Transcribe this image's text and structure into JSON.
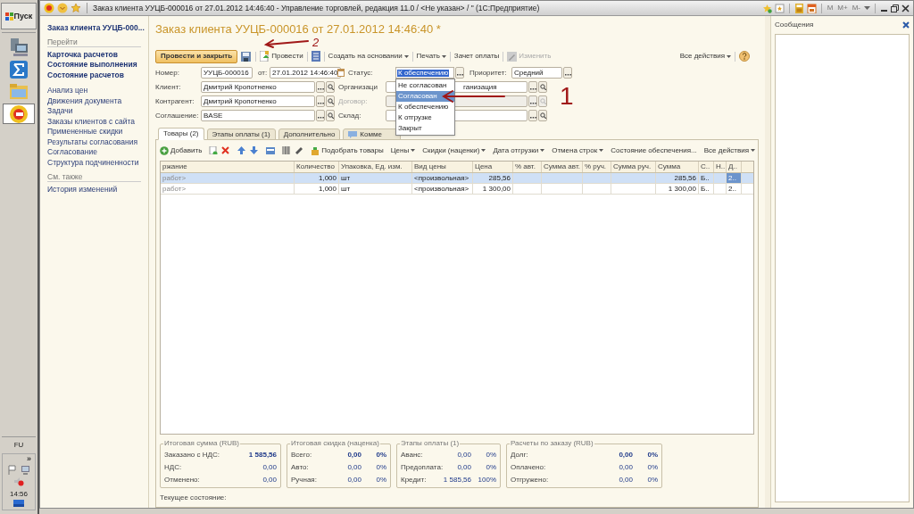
{
  "taskbar": {
    "start": "Пуск",
    "apps": [
      {
        "kind": "computer",
        "selected": false
      },
      {
        "kind": "sigma",
        "selected": false
      },
      {
        "kind": "folder",
        "selected": false
      },
      {
        "kind": "onec",
        "selected": true
      }
    ],
    "language": "FU",
    "tray_chevron": "»",
    "clock": "14:56"
  },
  "window": {
    "title": "Заказ клиента УУЦБ-000016 от 27.01.2012 14:46:40 - Управление торговлей, редакция 11.0 / <Не указан> / \" (1С:Предприятие)",
    "tools": [
      "M",
      "M+",
      "M-"
    ]
  },
  "nav": {
    "title": "Заказ клиента УУЦБ-000...",
    "sections": [
      {
        "heading": "Перейти",
        "items": [
          {
            "label": "Карточка расчетов",
            "bold": true
          },
          {
            "label": "Состояние выполнения",
            "bold": true
          },
          {
            "label": "Состояние расчетов",
            "bold": true
          },
          {
            "label": "Анализ цен",
            "bold": false
          },
          {
            "label": "Движения документа",
            "bold": false
          },
          {
            "label": "Задачи",
            "bold": false
          },
          {
            "label": "Заказы клиентов с сайта",
            "bold": false
          },
          {
            "label": "Примененные скидки",
            "bold": false
          },
          {
            "label": "Результаты согласования",
            "bold": false
          },
          {
            "label": "Согласование",
            "bold": false
          },
          {
            "label": "Структура подчиненности",
            "bold": false
          }
        ]
      },
      {
        "heading": "См. также",
        "items": [
          {
            "label": "История изменений",
            "bold": false
          }
        ]
      }
    ]
  },
  "form": {
    "title": "Заказ клиента УУЦБ-000016 от 27.01.2012 14:46:40 *",
    "toolbar": [
      {
        "kind": "primary",
        "label": "Провести и закрыть",
        "disabled": false
      },
      {
        "kind": "save"
      },
      {
        "kind": "post",
        "label": "Провести",
        "disabled": false
      },
      {
        "kind": "structure"
      },
      {
        "kind": "menu",
        "label": "Создать на основании",
        "disabled": false
      },
      {
        "kind": "menu",
        "label": "Печать",
        "disabled": false
      },
      {
        "kind": "plain",
        "label": "Зачет оплаты",
        "disabled": false
      },
      {
        "kind": "edit",
        "label": "Изменить",
        "disabled": true
      }
    ],
    "all_actions": "Все действия",
    "fields": {
      "number": {
        "label": "Номер:",
        "value": "УУЦБ-000016"
      },
      "date": {
        "label": "от:",
        "value": "27.01.2012 14:46:40"
      },
      "status": {
        "label": "Статус:",
        "value": "К обеспечению"
      },
      "priority": {
        "label": "Приоритет:",
        "value": "Средний"
      },
      "client": {
        "label": "Клиент:",
        "value": "Дмитрий Кропотненко"
      },
      "organization": {
        "label": "Организаци",
        "value": "ганизация"
      },
      "counterparty": {
        "label": "Контрагент:",
        "value": "Дмитрий Кропотненко"
      },
      "contract": {
        "label": "Договор:",
        "disabled": true
      },
      "agreement": {
        "label": "Соглашение:",
        "value": "BASE"
      },
      "warehouse": {
        "label": "Склад:",
        "disabled": false
      }
    },
    "status_options": [
      {
        "label": "Не согласован",
        "selected": false
      },
      {
        "label": "Согласован",
        "selected": true
      },
      {
        "label": "К обеспечению",
        "selected": false
      },
      {
        "label": "К отгрузке",
        "selected": false
      },
      {
        "label": "Закрыт",
        "selected": false
      }
    ],
    "tabs": [
      {
        "label": "Товары (2)",
        "selected": true,
        "kind": "plain"
      },
      {
        "label": "Этапы оплаты (1)",
        "selected": false,
        "kind": "plain"
      },
      {
        "label": "Дополнительно",
        "selected": false,
        "kind": "plain"
      },
      {
        "label": "Комме",
        "selected": false,
        "kind": "comment"
      }
    ],
    "table_toolbar": [
      {
        "kind": "add",
        "label": "Добавить"
      },
      {
        "kind": "copy"
      },
      {
        "kind": "delete"
      },
      {
        "kind": "up"
      },
      {
        "kind": "down"
      },
      {
        "kind": "form"
      },
      {
        "kind": "barcode"
      },
      {
        "kind": "tool"
      },
      {
        "kind": "pick",
        "label": "Подобрать товары"
      },
      {
        "kind": "menu",
        "label": "Цены"
      },
      {
        "kind": "menu",
        "label": "Скидки (наценки)"
      },
      {
        "kind": "menu",
        "label": "Дата отгрузки"
      },
      {
        "kind": "menu",
        "label": "Отмена строк"
      },
      {
        "kind": "plain",
        "label": "Состояние обеспечения..."
      }
    ],
    "table_all_actions": "Все действия",
    "table": {
      "columns": [
        "ржание",
        "Количество",
        "Упаковка, Ед. изм.",
        "Вид цены",
        "Цена",
        "% авт.",
        "Сумма авт.",
        "% руч.",
        "Сумма руч.",
        "Сумма",
        "С..",
        "Н..",
        "Д.."
      ],
      "rows": [
        {
          "selected": true,
          "cells": [
            "работ>",
            "1,000",
            "шт",
            "<произвольная>",
            "285,56",
            "",
            "",
            "",
            "",
            "285,56",
            "Б..",
            "",
            "2.."
          ]
        },
        {
          "selected": false,
          "cells": [
            "работ>",
            "1,000",
            "шт",
            "<произвольная>",
            "1 300,00",
            "",
            "",
            "",
            "",
            "1 300,00",
            "Б..",
            "",
            "2.."
          ]
        }
      ]
    },
    "summaries": [
      {
        "title": "Итоговая сумма (RUB)",
        "rows": [
          {
            "label": "Заказано с НДС:",
            "value": "1 585,56",
            "emphasis": true
          },
          {
            "label": "НДС:",
            "value": "0,00",
            "emphasis": false
          },
          {
            "label": "Отменено:",
            "value": "0,00",
            "emphasis": false
          }
        ]
      },
      {
        "title": "Итоговая скидка (наценка)",
        "rows": [
          {
            "label": "Всего:",
            "value": "0,00",
            "percent": "0%",
            "emphasis": true
          },
          {
            "label": "Авто:",
            "value": "0,00",
            "percent": "0%",
            "emphasis": false
          },
          {
            "label": "Ручная:",
            "value": "0,00",
            "percent": "0%",
            "emphasis": false
          }
        ]
      },
      {
        "title": "Этапы оплаты (1)",
        "rows": [
          {
            "label": "Аванс:",
            "value": "0,00",
            "percent": "0%",
            "emphasis": false
          },
          {
            "label": "Предоплата:",
            "value": "0,00",
            "percent": "0%",
            "emphasis": false
          },
          {
            "label": "Кредит:",
            "value": "1 585,56",
            "percent": "100%",
            "emphasis": false
          }
        ]
      },
      {
        "title": "Расчеты по заказу (RUB)",
        "rows": [
          {
            "label": "Долг:",
            "value": "0,00",
            "percent": "0%",
            "emphasis": true
          },
          {
            "label": "Оплачено:",
            "value": "0,00",
            "percent": "0%",
            "emphasis": false
          },
          {
            "label": "Отгружено:",
            "value": "0,00",
            "percent": "0%",
            "emphasis": false
          }
        ]
      }
    ],
    "current_state": "Текущее состояние:"
  },
  "annotations": [
    "2",
    "1"
  ],
  "messages": {
    "title": "Сообщения"
  }
}
